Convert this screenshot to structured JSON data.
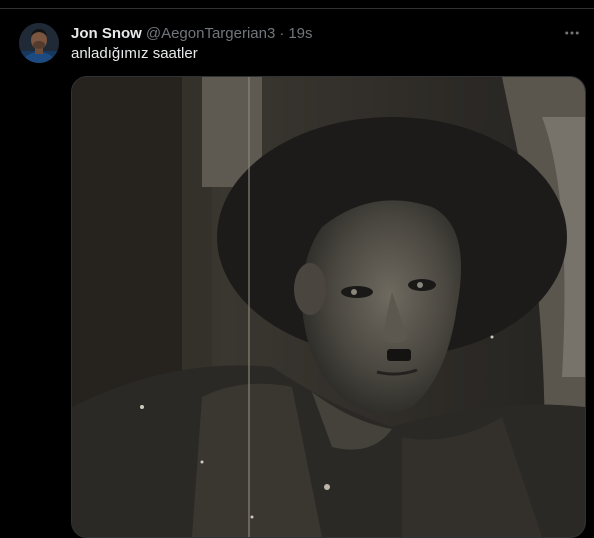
{
  "tweet": {
    "display_name": "Jon Snow",
    "handle": "@AegonTargerian3",
    "separator": "·",
    "time": "19s",
    "text": "anladığımız saatler",
    "more_icon": "more-horizontal-icon"
  },
  "colors": {
    "background": "#000000",
    "text_primary": "#e7e9ea",
    "text_secondary": "#71767b",
    "border": "#2f3336"
  }
}
